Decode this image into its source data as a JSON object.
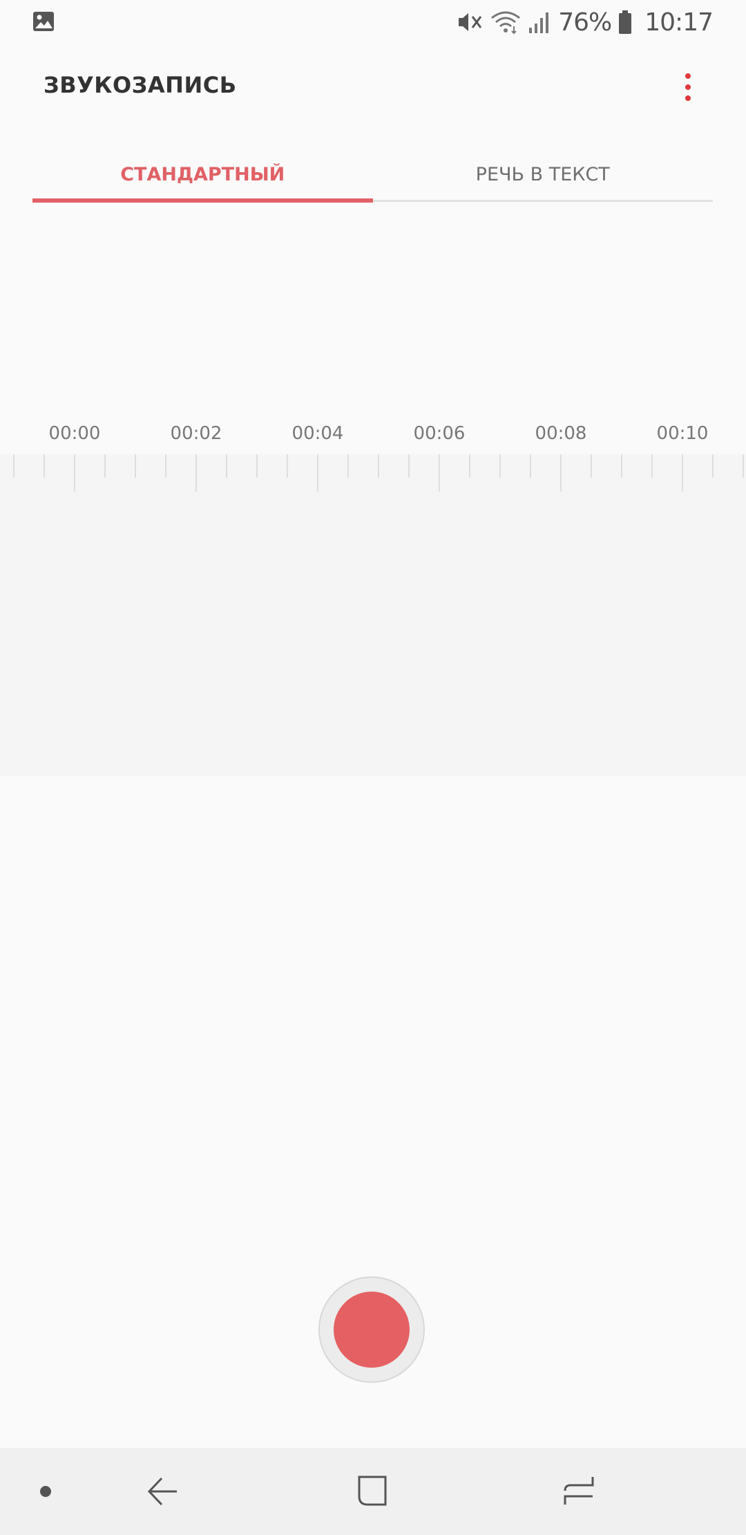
{
  "status_bar": {
    "battery_percent": "76%",
    "time": "10:17",
    "icons": [
      "gallery-icon",
      "vibrate-off-icon",
      "wifi-icon",
      "signal-icon",
      "battery-icon"
    ]
  },
  "app_bar": {
    "title": "ЗВУКОЗАПИСЬ",
    "more_icon": "more-vertical-icon"
  },
  "tabs": [
    {
      "label": "СТАНДАРТНЫЙ",
      "active": true
    },
    {
      "label": "РЕЧЬ В ТЕКСТ",
      "active": false
    }
  ],
  "timeline": {
    "labels": [
      "00:00",
      "00:02",
      "00:04",
      "00:06",
      "00:08",
      "00:10"
    ]
  },
  "record": {
    "icon": "record-icon"
  },
  "nav_bar": {
    "icons": [
      "nav-dot-icon",
      "back-icon",
      "home-icon",
      "recents-icon"
    ]
  },
  "colors": {
    "accent": "#e06166",
    "record": "#e56062",
    "menu_dots": "#e0393e",
    "background": "#fafafa",
    "timeline_bg": "#f5f5f5",
    "nav_bg": "#f0f0f0"
  }
}
